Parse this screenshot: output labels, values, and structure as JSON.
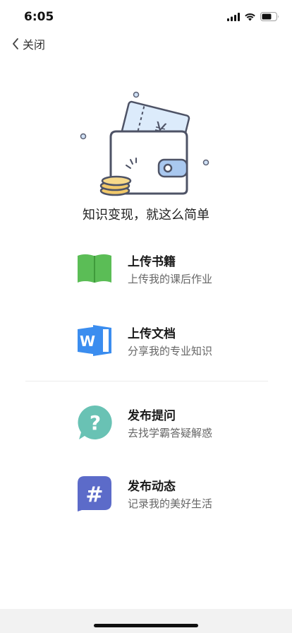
{
  "status_bar": {
    "time": "6:05",
    "icons": [
      "cellular-signal-icon",
      "wifi-icon",
      "battery-icon"
    ]
  },
  "nav": {
    "close_label": "关闭",
    "back_icon": "chevron-left-icon"
  },
  "hero": {
    "illustration": "wallet-with-ticket-and-coins",
    "ticket_symbol": "¥",
    "tagline": "知识变现，就这么简单"
  },
  "actions": [
    {
      "title": "上传书籍",
      "subtitle": "上传我的课后作业",
      "icon": "book-icon",
      "color": "#5bbd56"
    },
    {
      "title": "上传文档",
      "subtitle": "分享我的专业知识",
      "icon": "word-document-icon",
      "color": "#3b8def"
    },
    {
      "title": "发布提问",
      "subtitle": "去找学霸答疑解惑",
      "icon": "question-bubble-icon",
      "color": "#69c2b4"
    },
    {
      "title": "发布动态",
      "subtitle": "记录我的美好生活",
      "icon": "hashtag-bubble-icon",
      "color": "#5c6bc9"
    }
  ]
}
